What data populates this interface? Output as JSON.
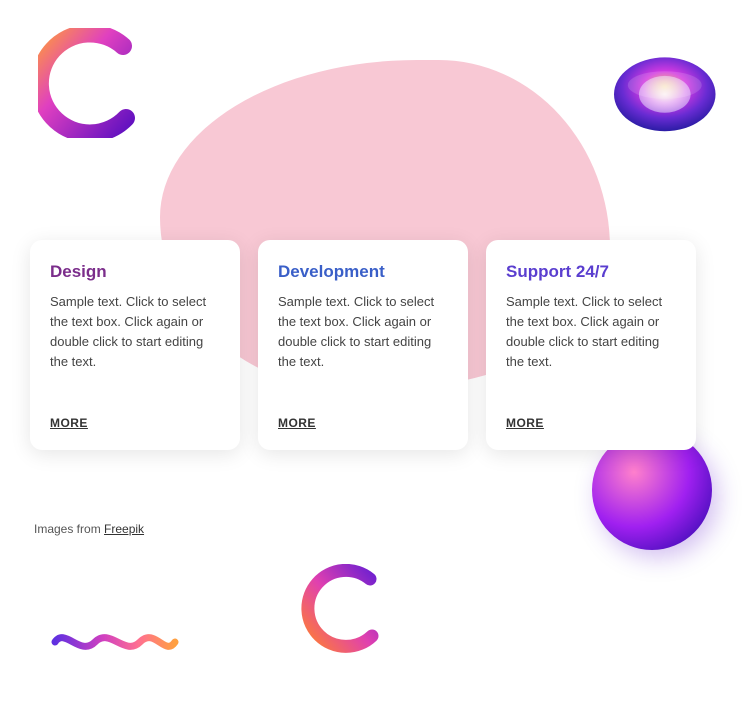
{
  "blob": {},
  "cards": [
    {
      "id": "design",
      "title": "Design",
      "titleColor": "purple",
      "text": "Sample text. Click to select the text box. Click again or double click to start editing the text.",
      "link": "MORE"
    },
    {
      "id": "development",
      "title": "Development",
      "titleColor": "blue",
      "text": "Sample text. Click to select the text box. Click again or double click to start editing the text.",
      "link": "MORE"
    },
    {
      "id": "support",
      "title": "Support 24/7",
      "titleColor": "indigo",
      "text": "Sample text. Click to select the text box. Click again or double click to start editing the text.",
      "link": "MORE"
    }
  ],
  "footer": {
    "text": "Images from ",
    "link_label": "Freepik",
    "link_url": "#"
  }
}
